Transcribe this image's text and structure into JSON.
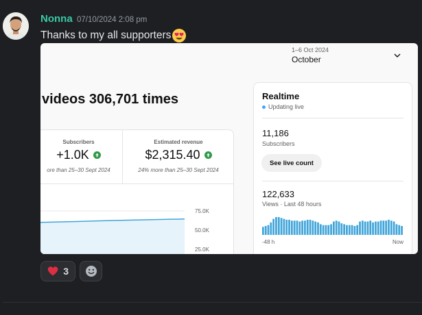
{
  "message": {
    "author": "Nonna",
    "timestamp": "07/10/2024 2:08 pm",
    "text": "Thanks to my all supporters",
    "emoji": "heart-eyes-emoji",
    "colors": {
      "author": "#3ac9a7",
      "background": "#1e1f22",
      "text": "#e6e7e9"
    }
  },
  "embed": {
    "date_range": "1–6 Oct 2024",
    "month": "October",
    "headline": "videos 306,701 times",
    "metrics": [
      {
        "label": "Subscribers",
        "value": "+1.0K",
        "compare": "ore than 25–30 Sept 2024"
      },
      {
        "label": "Estimated revenue",
        "value": "$2,315.40",
        "compare": "24% more than 25–30 Sept 2024"
      }
    ],
    "chart_data": {
      "type": "line",
      "y_ticks": [
        "75.0K",
        "50.0K",
        "25.0K"
      ],
      "ylim": [
        25000,
        75000
      ],
      "series": [
        {
          "values": [
            60000,
            61200,
            62500,
            63500,
            64500
          ]
        }
      ],
      "colors": {
        "line": "#41a5d9",
        "fill": "#e6f3fb"
      }
    },
    "realtime": {
      "title": "Realtime",
      "status": "Updating live",
      "subscribers_value": "11,186",
      "subscribers_label": "Subscribers",
      "button_label": "See live count",
      "views_value": "122,633",
      "views_label": "Views · Last 48 hours",
      "axis_left": "-48 h",
      "axis_right": "Now",
      "bars": [
        0.45,
        0.5,
        0.55,
        0.7,
        0.9,
        1,
        1,
        0.95,
        0.9,
        0.85,
        0.85,
        0.8,
        0.8,
        0.8,
        0.75,
        0.8,
        0.8,
        0.85,
        0.85,
        0.8,
        0.75,
        0.7,
        0.6,
        0.55,
        0.55,
        0.55,
        0.6,
        0.75,
        0.8,
        0.75,
        0.65,
        0.6,
        0.55,
        0.55,
        0.55,
        0.5,
        0.55,
        0.75,
        0.8,
        0.75,
        0.75,
        0.8,
        0.7,
        0.75,
        0.75,
        0.8,
        0.8,
        0.8,
        0.85,
        0.8,
        0.75,
        0.6,
        0.55,
        0.5
      ],
      "bar_color": "#41a5d9"
    }
  },
  "reactions": [
    {
      "icon": "heart-icon",
      "count": "3"
    },
    {
      "icon": "add-reaction-icon"
    }
  ]
}
